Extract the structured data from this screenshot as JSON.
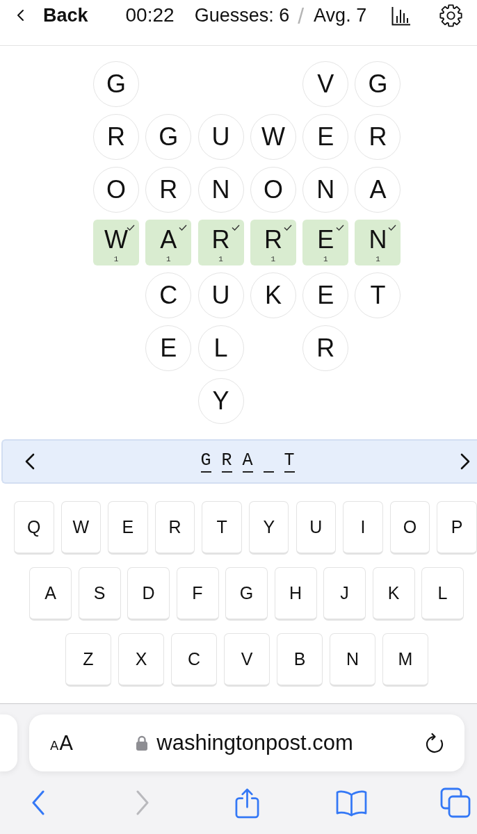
{
  "top_bar": {
    "back_label": "Back",
    "timer": "00:22",
    "guesses": "Guesses: 6",
    "separator": "/",
    "average": "Avg. 7"
  },
  "grid": {
    "rows": [
      {
        "cells": [
          {
            "kind": "letter",
            "letter": "G"
          },
          {
            "kind": "empty"
          },
          {
            "kind": "empty"
          },
          {
            "kind": "empty"
          },
          {
            "kind": "letter",
            "letter": "V"
          },
          {
            "kind": "letter",
            "letter": "G"
          }
        ]
      },
      {
        "cells": [
          {
            "kind": "letter",
            "letter": "R"
          },
          {
            "kind": "letter",
            "letter": "G"
          },
          {
            "kind": "letter",
            "letter": "U"
          },
          {
            "kind": "letter",
            "letter": "W"
          },
          {
            "kind": "letter",
            "letter": "E"
          },
          {
            "kind": "letter",
            "letter": "R"
          }
        ]
      },
      {
        "cells": [
          {
            "kind": "letter",
            "letter": "O"
          },
          {
            "kind": "letter",
            "letter": "R"
          },
          {
            "kind": "letter",
            "letter": "N"
          },
          {
            "kind": "letter",
            "letter": "O"
          },
          {
            "kind": "letter",
            "letter": "N"
          },
          {
            "kind": "letter",
            "letter": "A"
          }
        ]
      },
      {
        "cells": [
          {
            "kind": "found",
            "letter": "W",
            "count": "1",
            "checked": true
          },
          {
            "kind": "found",
            "letter": "A",
            "count": "1",
            "checked": true
          },
          {
            "kind": "found",
            "letter": "R",
            "count": "1",
            "checked": true
          },
          {
            "kind": "found",
            "letter": "R",
            "count": "1",
            "checked": true
          },
          {
            "kind": "found",
            "letter": "E",
            "count": "1",
            "checked": true
          },
          {
            "kind": "found",
            "letter": "N",
            "count": "1",
            "checked": true
          }
        ]
      },
      {
        "cells": [
          {
            "kind": "empty"
          },
          {
            "kind": "letter",
            "letter": "C"
          },
          {
            "kind": "letter",
            "letter": "U"
          },
          {
            "kind": "letter",
            "letter": "K"
          },
          {
            "kind": "letter",
            "letter": "E"
          },
          {
            "kind": "letter",
            "letter": "T"
          }
        ]
      },
      {
        "cells": [
          {
            "kind": "empty"
          },
          {
            "kind": "letter",
            "letter": "E"
          },
          {
            "kind": "letter",
            "letter": "L"
          },
          {
            "kind": "empty"
          },
          {
            "kind": "letter",
            "letter": "R"
          },
          {
            "kind": "empty"
          }
        ]
      },
      {
        "cells": [
          {
            "kind": "empty"
          },
          {
            "kind": "empty"
          },
          {
            "kind": "letter",
            "letter": "Y"
          },
          {
            "kind": "empty"
          },
          {
            "kind": "empty"
          },
          {
            "kind": "empty"
          }
        ]
      }
    ]
  },
  "clue_bar": {
    "slots": [
      {
        "kind": "letter",
        "letter": "G"
      },
      {
        "kind": "letter",
        "letter": "R"
      },
      {
        "kind": "letter",
        "letter": "A"
      },
      {
        "kind": "blank"
      },
      {
        "kind": "letter",
        "letter": "T"
      }
    ]
  },
  "keyboard": {
    "rows": [
      [
        "Q",
        "W",
        "E",
        "R",
        "T",
        "Y",
        "U",
        "I",
        "O",
        "P"
      ],
      [
        "A",
        "S",
        "D",
        "F",
        "G",
        "H",
        "J",
        "K",
        "L"
      ],
      [
        "Z",
        "X",
        "C",
        "V",
        "B",
        "N",
        "M"
      ]
    ]
  },
  "browser": {
    "text_size_label": "AA",
    "url": "washingtonpost.com",
    "toolbar": [
      {
        "kind": "back",
        "disabled": false
      },
      {
        "kind": "forward",
        "disabled": true
      },
      {
        "kind": "share",
        "disabled": false
      },
      {
        "kind": "bookmarks",
        "disabled": false
      },
      {
        "kind": "tabs",
        "disabled": false
      }
    ]
  }
}
